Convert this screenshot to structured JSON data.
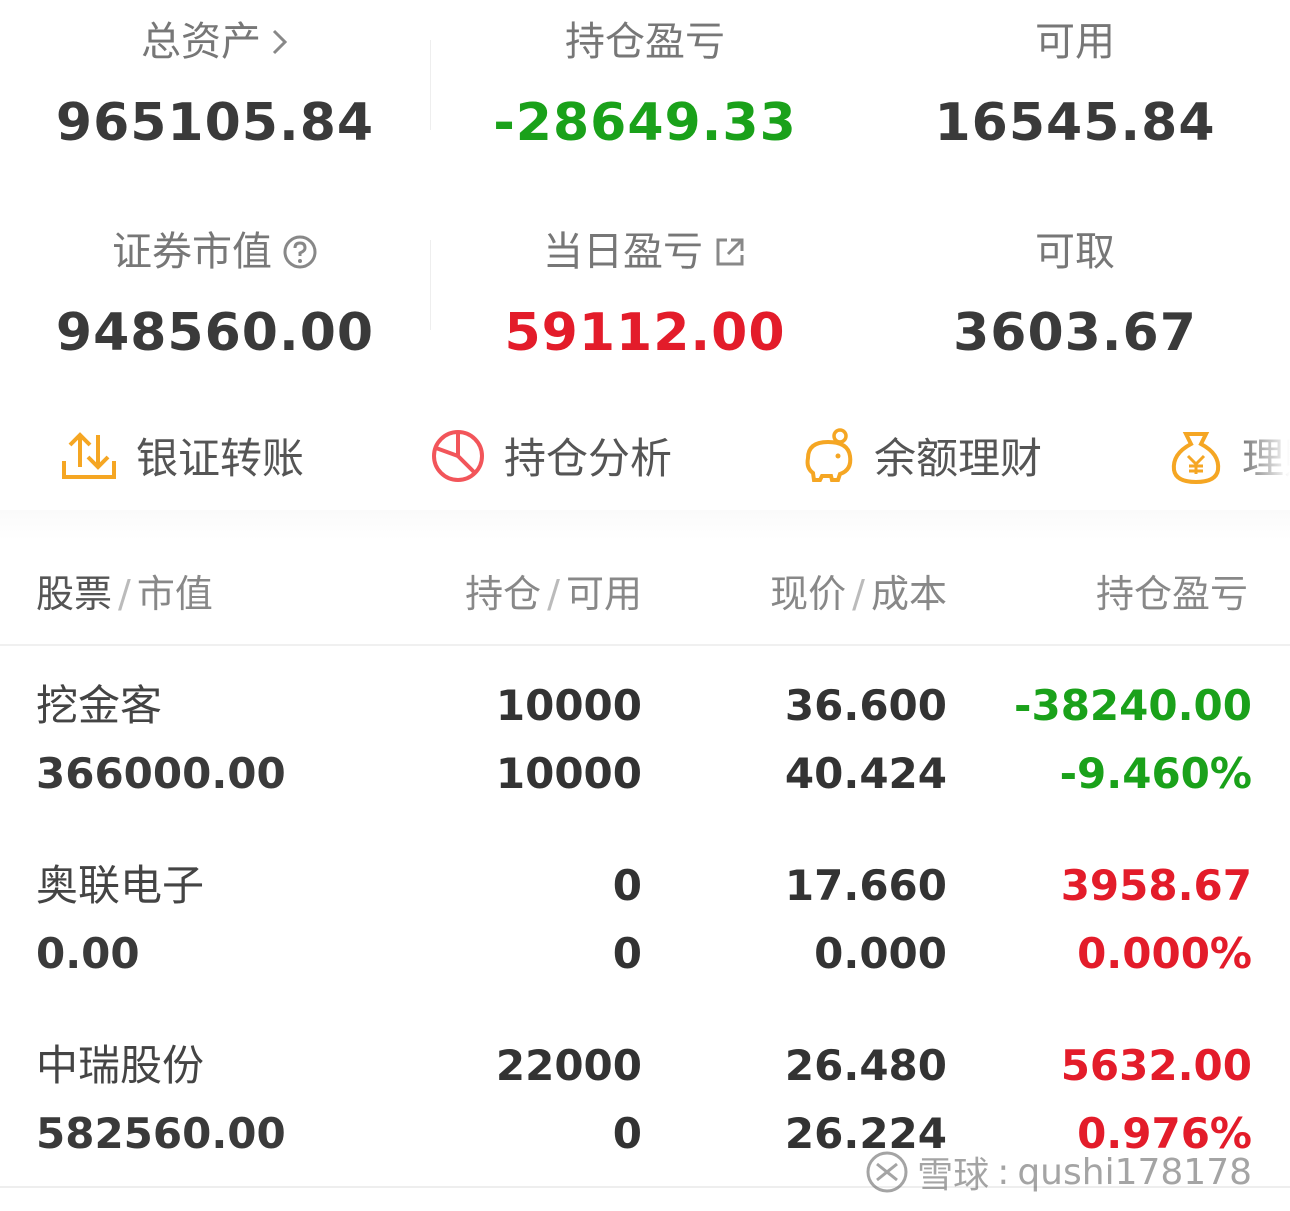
{
  "summary": {
    "total_assets": {
      "label": "总资产",
      "value": "965105.84"
    },
    "position_pnl": {
      "label": "持仓盈亏",
      "value": "-28649.33"
    },
    "available": {
      "label": "可用",
      "value": "16545.84"
    },
    "securities_value": {
      "label": "证券市值",
      "value": "948560.00"
    },
    "daily_pnl": {
      "label": "当日盈亏",
      "value": "59112.00"
    },
    "withdrawable": {
      "label": "可取",
      "value": "3603.67"
    }
  },
  "actions": [
    {
      "label": "银证转账",
      "icon": "transfer-icon"
    },
    {
      "label": "持仓分析",
      "icon": "pie-chart-icon"
    },
    {
      "label": "余额理财",
      "icon": "piggy-bank-icon"
    },
    {
      "label": "理财",
      "icon": "money-bag-icon"
    }
  ],
  "table": {
    "headers": {
      "stock": "股票",
      "market_value": "市值",
      "position": "持仓",
      "available": "可用",
      "price": "现价",
      "cost": "成本",
      "pnl": "持仓盈亏"
    },
    "rows": [
      {
        "name": "挖金客",
        "market_value": "366000.00",
        "position": "10000",
        "available": "10000",
        "price": "36.600",
        "cost": "40.424",
        "pnl": "-38240.00",
        "pct": "-9.460%"
      },
      {
        "name": "奥联电子",
        "market_value": "0.00",
        "position": "0",
        "available": "0",
        "price": "17.660",
        "cost": "0.000",
        "pnl": "3958.67",
        "pct": "0.000%"
      },
      {
        "name": "中瑞股份",
        "market_value": "582560.00",
        "position": "22000",
        "available": "0",
        "price": "26.480",
        "cost": "26.224",
        "pnl": "5632.00",
        "pct": "0.976%"
      }
    ]
  },
  "watermark": {
    "brand": "雪球",
    "user": "qushi178178"
  },
  "colors": {
    "gain": "#e31c2a",
    "loss": "#1aa11a",
    "accent": "#f5a623"
  }
}
